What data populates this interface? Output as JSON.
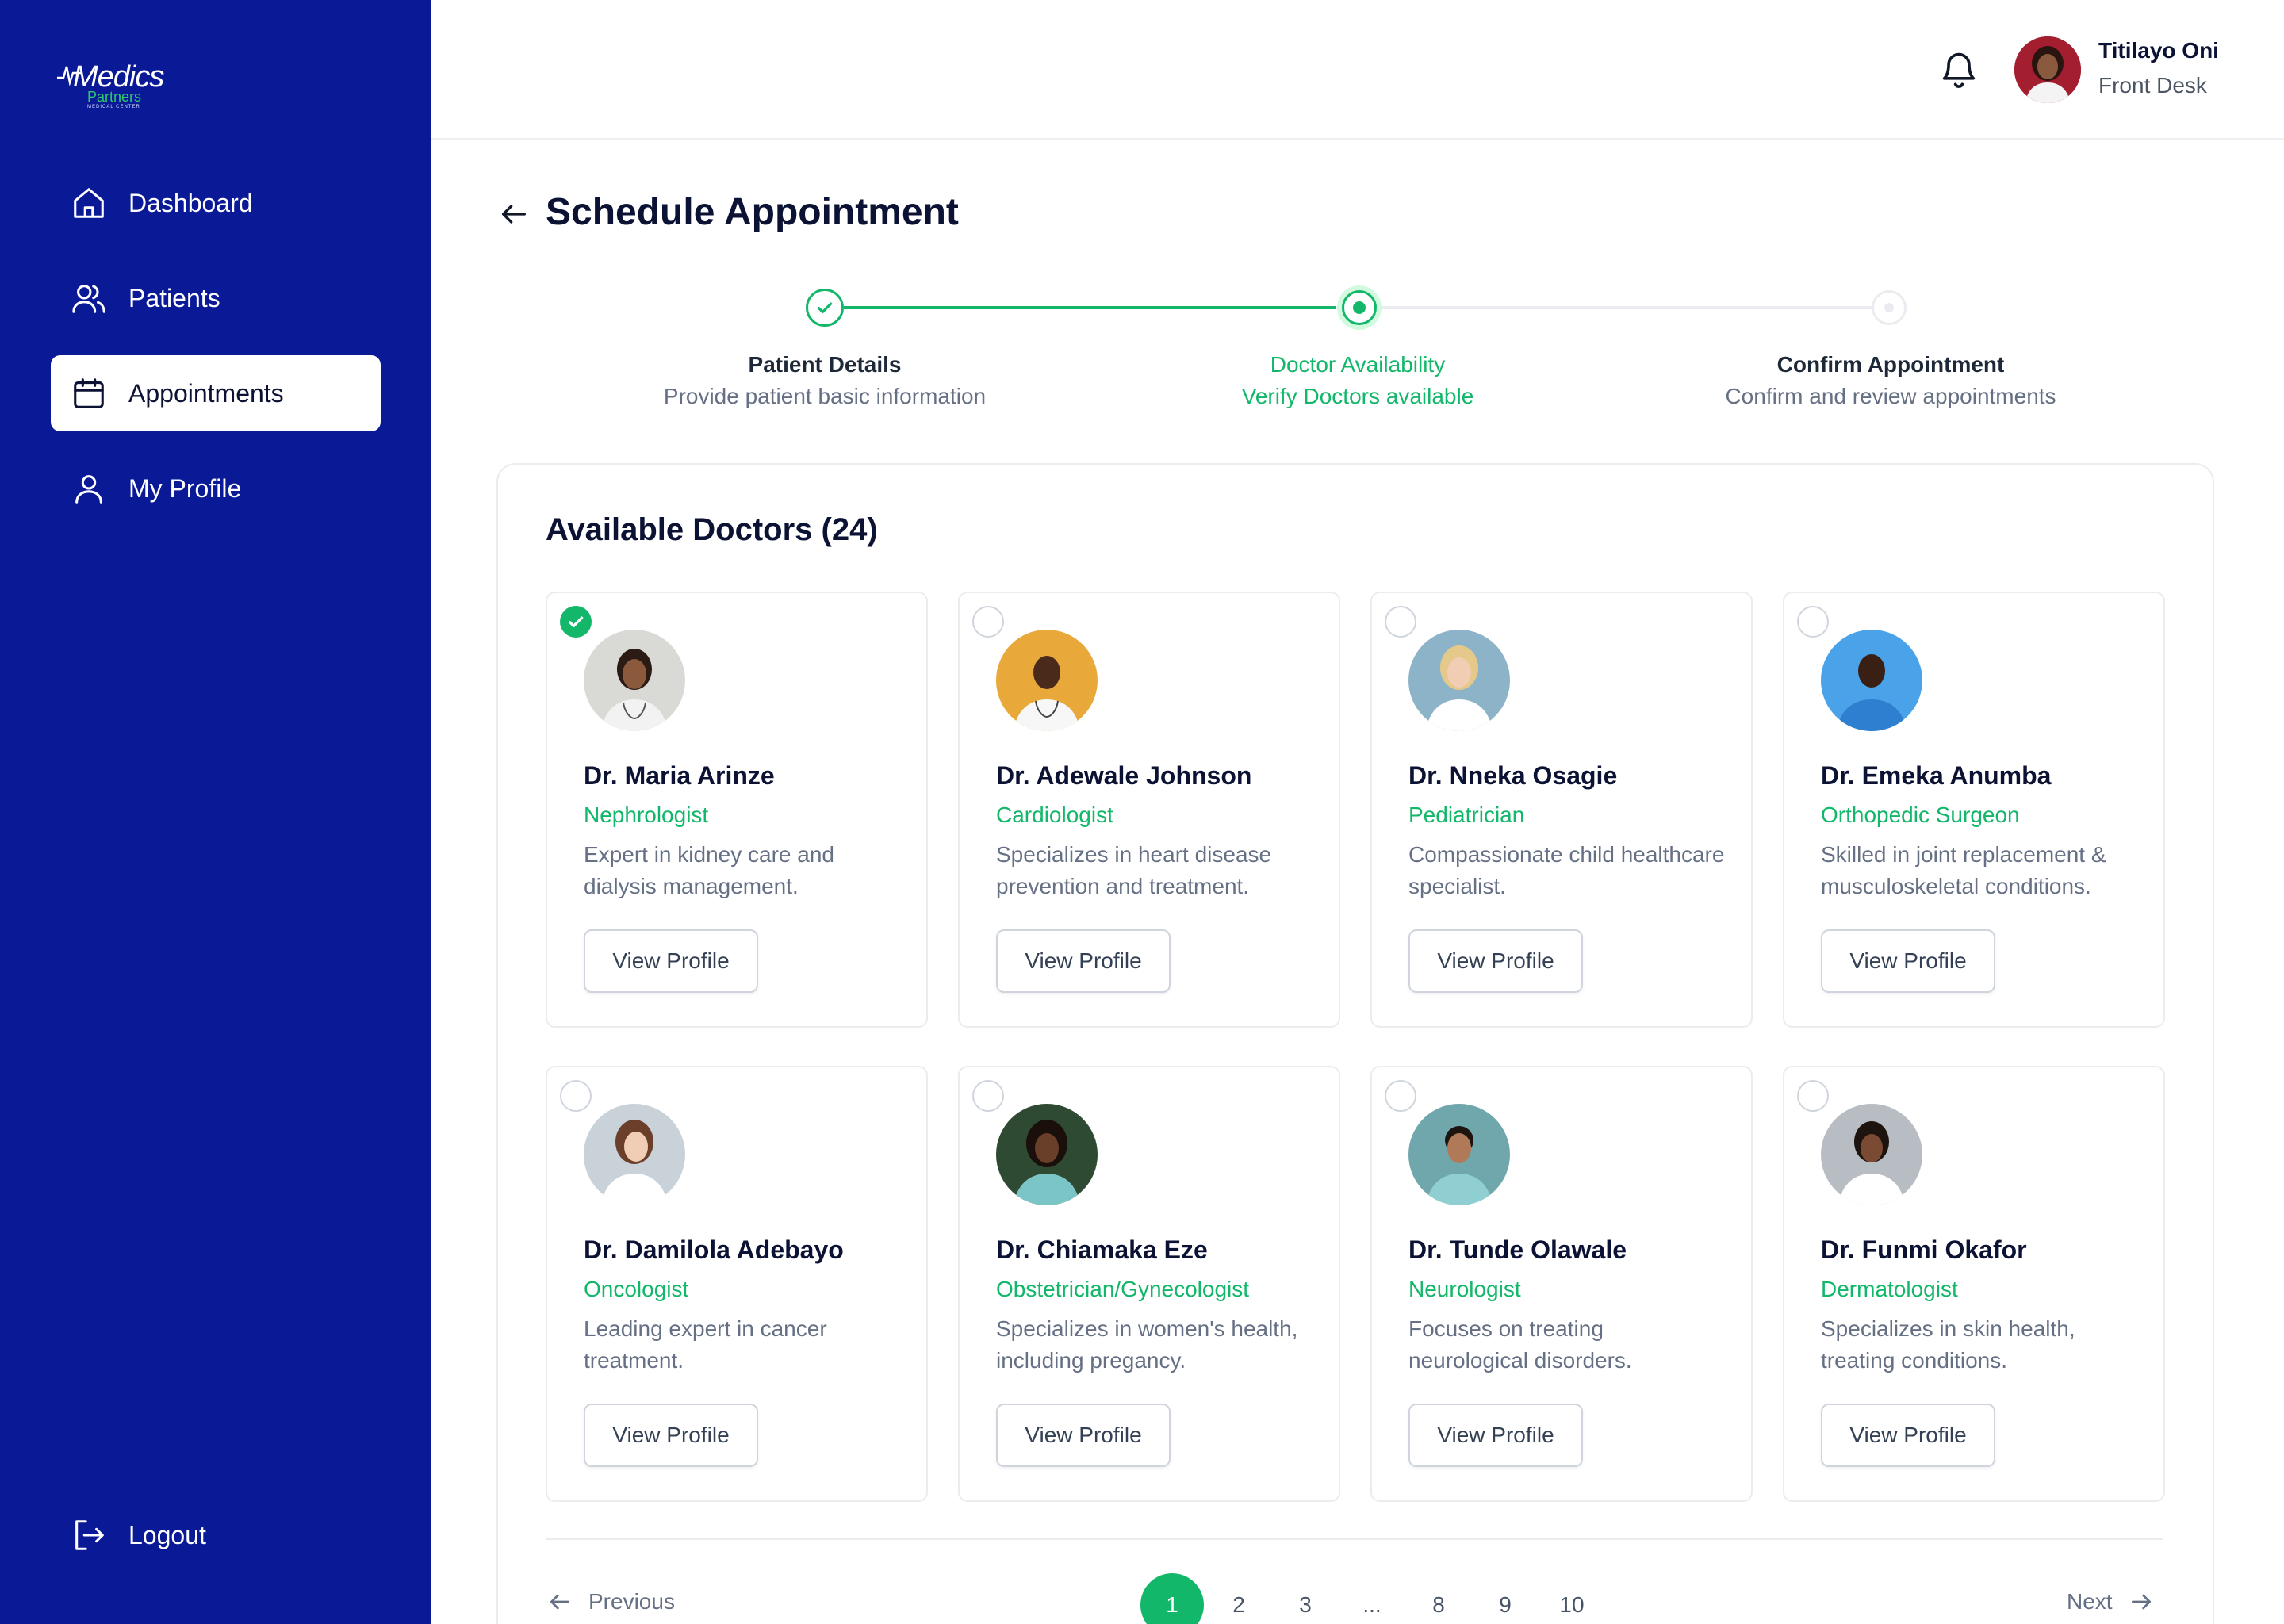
{
  "brand": {
    "name": "Medics",
    "sub": "Partners",
    "tagline": "MEDICAL CENTER",
    "primary": "#0A1A96",
    "accent": "#12B76A"
  },
  "sidebar": {
    "items": [
      {
        "label": "Dashboard",
        "icon": "home-icon"
      },
      {
        "label": "Patients",
        "icon": "users-icon"
      },
      {
        "label": "Appointments",
        "icon": "calendar-icon",
        "active": true
      },
      {
        "label": "My Profile",
        "icon": "user-icon"
      }
    ],
    "logout_label": "Logout"
  },
  "header": {
    "user_name": "Titilayo Oni",
    "user_role": "Front Desk"
  },
  "page": {
    "title": "Schedule Appointment"
  },
  "stepper": [
    {
      "title": "Patient Details",
      "desc": "Provide patient basic information",
      "state": "done"
    },
    {
      "title": "Doctor Availability",
      "desc": "Verify Doctors available",
      "state": "current"
    },
    {
      "title": "Confirm Appointment",
      "desc": "Confirm and review appointments",
      "state": "pending"
    }
  ],
  "doctors_panel": {
    "title": "Available Doctors (24)",
    "view_profile_label": "View Profile",
    "doctors": [
      {
        "name": "Dr. Maria Arinze",
        "specialty": "Nephrologist",
        "desc": "Expert in kidney care and dialysis management.",
        "selected": true
      },
      {
        "name": "Dr. Adewale Johnson",
        "specialty": "Cardiologist",
        "desc": "Specializes in heart disease prevention and treatment.",
        "selected": false
      },
      {
        "name": "Dr. Nneka Osagie",
        "specialty": "Pediatrician",
        "desc": "Compassionate child healthcare specialist.",
        "selected": false
      },
      {
        "name": "Dr. Emeka Anumba",
        "specialty": "Orthopedic Surgeon",
        "desc": "Skilled in joint replacement & musculoskeletal conditions.",
        "selected": false
      },
      {
        "name": "Dr. Damilola Adebayo",
        "specialty": "Oncologist",
        "desc": "Leading expert in cancer treatment.",
        "selected": false
      },
      {
        "name": "Dr. Chiamaka Eze",
        "specialty": "Obstetrician/Gynecologist",
        "desc": "Specializes in women's health, including pregancy.",
        "selected": false
      },
      {
        "name": "Dr. Tunde Olawale",
        "specialty": "Neurologist",
        "desc": "Focuses on  treating neurological disorders.",
        "selected": false
      },
      {
        "name": "Dr. Funmi Okafor",
        "specialty": "Dermatologist",
        "desc": "Specializes in skin health, treating conditions.",
        "selected": false
      }
    ]
  },
  "pagination": {
    "prev_label": "Previous",
    "next_label": "Next",
    "pages": [
      "1",
      "2",
      "3",
      "...",
      "8",
      "9",
      "10"
    ],
    "current": "1"
  }
}
